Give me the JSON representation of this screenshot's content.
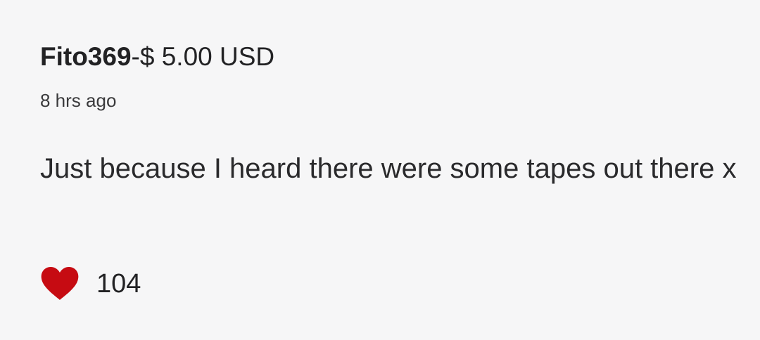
{
  "comment": {
    "username": "Fito369",
    "donation": "-$ 5.00 USD",
    "timestamp": "8 hrs ago",
    "text": "Just because I heard there were some tapes out there x",
    "likes": "104",
    "heart_icon": "heart-icon",
    "colors": {
      "background": "#f6f6f7",
      "text": "#2a2a2c",
      "heart": "#c60b12"
    }
  }
}
